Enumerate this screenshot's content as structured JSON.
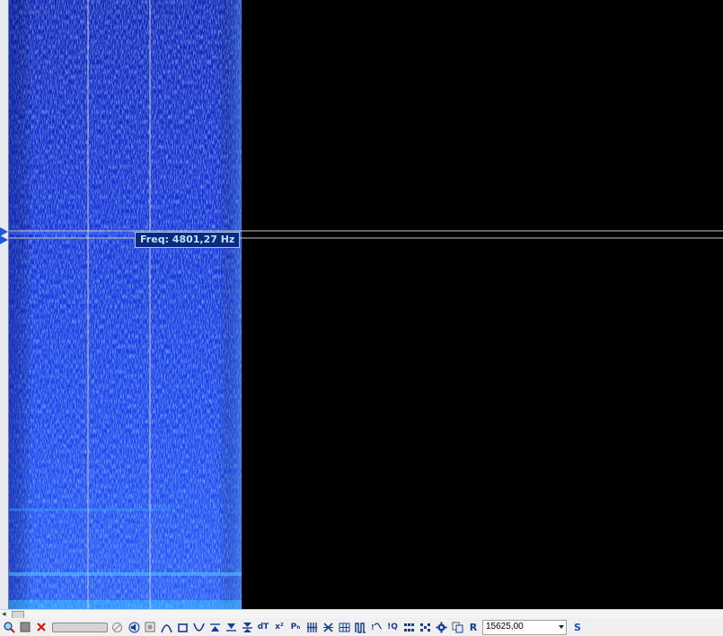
{
  "colors": {
    "spectrogram_background": "#000000",
    "signal_blue": "#1430e0",
    "cursor_line": "#c8c8c8",
    "label_text": "#bfe2ff",
    "toolbar": "#f0f0f0"
  },
  "cursor": {
    "freq_label": "Freq: 4801,27 Hz"
  },
  "toolbar": {
    "sample_rate_value": "15625,00",
    "icons": [
      "zoom-icon",
      "stop-icon",
      "delete-icon",
      "volume-slider",
      "cancel-icon",
      "sound-icon",
      "view-icon",
      "peak-icon",
      "square-icon",
      "valley-icon",
      "marker-up-icon",
      "marker-down-icon",
      "marker-both-icon",
      "delta-time-icon",
      "x-squared-icon",
      "p-h-icon",
      "harmonics-icon",
      "cross-icon",
      "grid-icon",
      "pulse-icon",
      "iq-icon",
      "i-q-icon",
      "blocks-icon",
      "blocks-alt-icon",
      "gear-icon",
      "copy-icon",
      "reset-icon",
      "sample-rate-combo",
      "settings-s-icon"
    ],
    "labels": {
      "dt": "dT",
      "x2": "x²",
      "ph": "Pₕ",
      "iq1": "!Q",
      "r": "R",
      "s": "S"
    }
  }
}
